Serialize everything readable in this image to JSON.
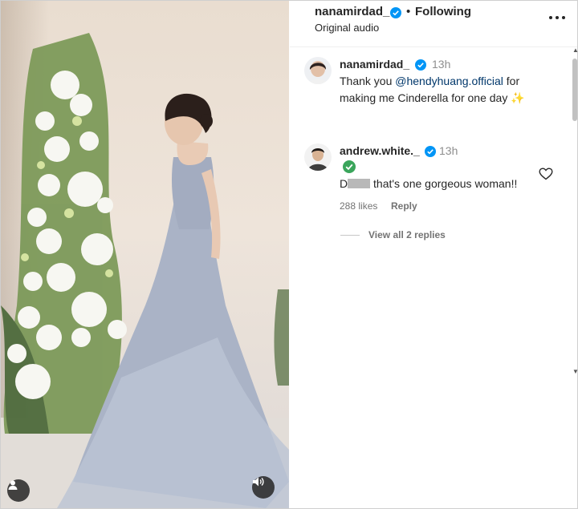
{
  "post": {
    "username": "nanamirdad_",
    "separator": "•",
    "follow_status": "Following",
    "audio": "Original audio"
  },
  "comments": [
    {
      "username": "nanamirdad_",
      "time": "13h",
      "text_before": "Thank you ",
      "mention": "@hendyhuang.official",
      "text_after": " for",
      "text_line2": "making me Cinderella for one day",
      "emoji": "✨"
    },
    {
      "username": "andrew.white._",
      "time": "13h",
      "text_prefix": "D",
      "text": " that's one gorgeous woman!!",
      "likes": "288 likes",
      "reply_label": "Reply",
      "view_replies": "View all 2 replies"
    }
  ],
  "icons": {
    "verified": "verified-badge-icon",
    "more": "more-options-icon",
    "heart": "heart-outline-icon",
    "tag": "user-tag-icon",
    "sound": "speaker-icon"
  },
  "colors": {
    "verified_blue": "#0095f6",
    "mention": "#00376b",
    "muted": "#737373",
    "text": "#262626"
  }
}
